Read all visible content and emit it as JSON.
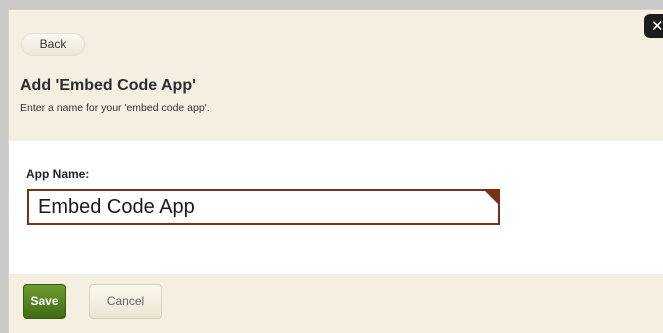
{
  "header": {
    "back_label": "Back",
    "close_label": "✕"
  },
  "dialog": {
    "title": "Add 'Embed Code App'",
    "subtitle": "Enter a name for your 'embed code app'."
  },
  "form": {
    "app_name_label": "App Name:",
    "app_name_value": "Embed Code App"
  },
  "actions": {
    "save_label": "Save",
    "cancel_label": "Cancel"
  },
  "colors": {
    "save_accent": "#4f7c1d",
    "input_border": "#7a3018",
    "panel_background": "#f4efe0"
  }
}
